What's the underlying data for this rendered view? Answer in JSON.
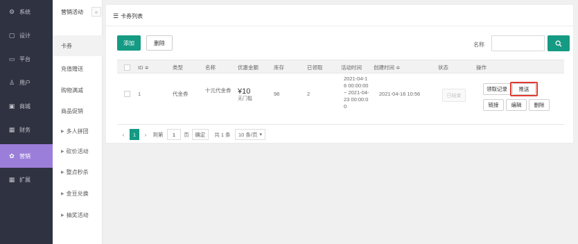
{
  "left_nav": [
    {
      "label": "系统",
      "icon": "gear-icon",
      "glyph": "⚙"
    },
    {
      "label": "设计",
      "icon": "monitor-icon",
      "glyph": "▢"
    },
    {
      "label": "平台",
      "icon": "desktop-icon",
      "glyph": "▭"
    },
    {
      "label": "用户",
      "icon": "users-icon",
      "glyph": "♙"
    },
    {
      "label": "商城",
      "icon": "store-icon",
      "glyph": "▣"
    },
    {
      "label": "财务",
      "icon": "wallet-icon",
      "glyph": "▦"
    },
    {
      "label": "营销",
      "icon": "gift-icon",
      "glyph": "✿"
    },
    {
      "label": "扩展",
      "icon": "grid-icon",
      "glyph": "▦"
    }
  ],
  "sub_nav": {
    "title": "营销活动",
    "collapse_glyph": "«",
    "items": [
      "卡券",
      "充值赠送",
      "购物满减",
      "商品促销"
    ],
    "groups": [
      "多人拼团",
      "砍价活动",
      "整点秒杀",
      "金豆兑换",
      "抽奖活动"
    ]
  },
  "panel": {
    "title": "卡券列表"
  },
  "toolbar": {
    "add_label": "添加",
    "delete_label": "删除",
    "search_label": "名称",
    "search_value": ""
  },
  "table": {
    "headers": [
      "ID",
      "类型",
      "名称",
      "优惠金额",
      "库存",
      "已领取",
      "活动时间",
      "创建时间",
      "状态",
      "操作"
    ],
    "sort_glyph": "≑",
    "rows": [
      {
        "id": "1",
        "type": "代金券",
        "name": "十元代金券",
        "discount": "¥10",
        "threshold": "无门槛",
        "stock": "98",
        "claimed": "2",
        "activity_time": "2021-04-16 00:00:00 ~ 2021-04-23 00:00:00",
        "created": "2021-04-16 10:56",
        "status": "已结束",
        "actions": {
          "records": "领取记录",
          "push": "推送",
          "link": "链接",
          "edit": "编辑",
          "delete": "删除"
        }
      }
    ]
  },
  "pager": {
    "prev": "‹",
    "current": "1",
    "next": "›",
    "goto_prefix": "到第",
    "goto_value": "1",
    "goto_suffix": "页",
    "confirm": "确定",
    "total": "共 1 条",
    "page_size": "10 条/页"
  },
  "colors": {
    "accent": "#159a83",
    "nav_bg": "#2f3240",
    "nav_active": "#9b7ed9",
    "highlight": "#e03a2f"
  }
}
